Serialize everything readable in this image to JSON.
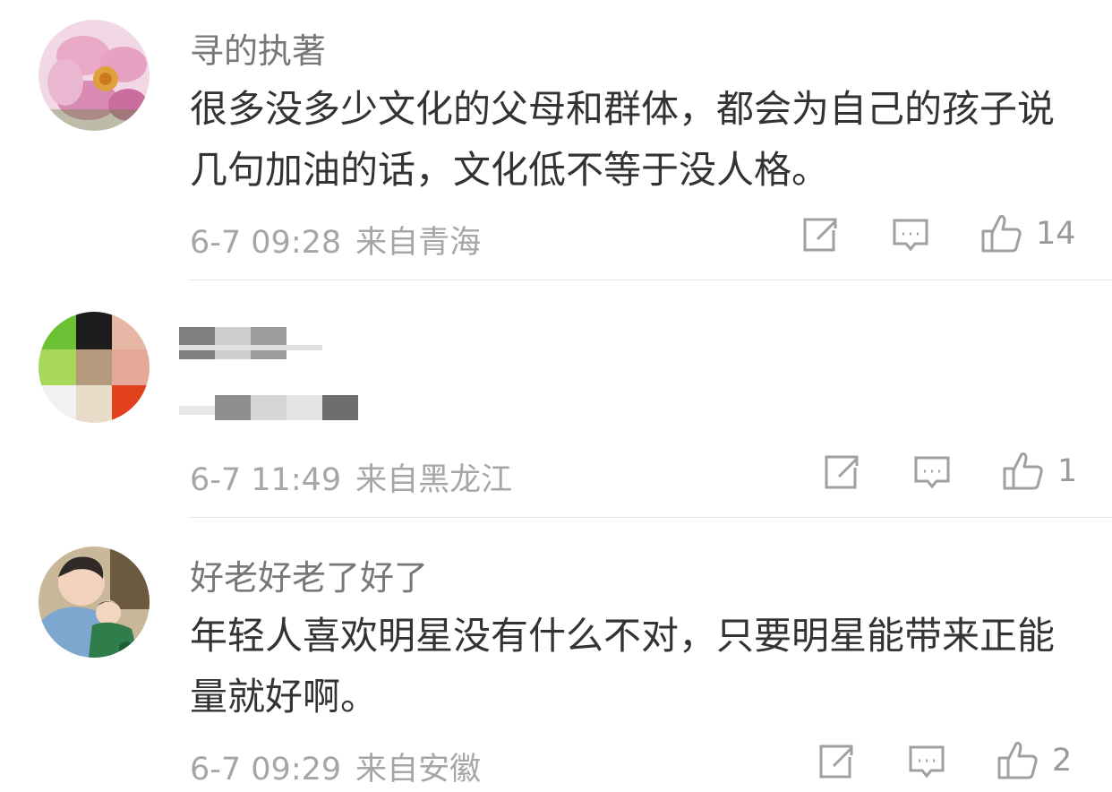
{
  "comments": [
    {
      "username": "寻的执著",
      "content": "很多没多少文化的父母和群体，都会为自己的孩子说几句加油的话，文化低不等于没人格。",
      "time": "6-7 09:28",
      "location": "来自青海",
      "likes": "14"
    },
    {
      "username": "",
      "content": "",
      "time": "6-7 11:49",
      "location": "来自黑龙江",
      "likes": "1"
    },
    {
      "username": "好老好老了好了",
      "content": "年轻人喜欢明星没有什么不对，只要明星能带来正能量就好啊。",
      "time": "6-7 09:29",
      "location": "来自安徽",
      "likes": "2"
    }
  ],
  "icons": {
    "repost": "share-edit-icon",
    "comment": "comment-bubble-icon",
    "like": "thumbs-up-icon"
  },
  "colors": {
    "username": "#777777",
    "content": "#333333",
    "meta": "#a6a6a6",
    "icon": "#a0a0a0",
    "divider": "#e6e6e6"
  }
}
